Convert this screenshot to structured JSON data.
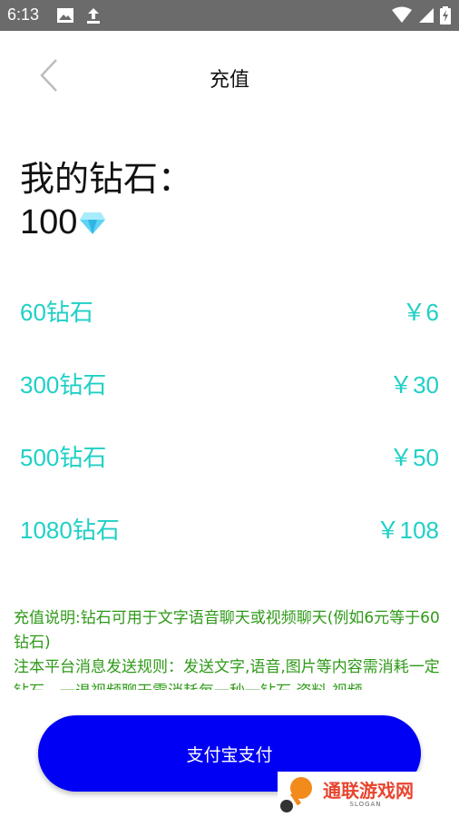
{
  "status_bar": {
    "time": "6:13"
  },
  "header": {
    "title": "充值"
  },
  "balance": {
    "label": "我的钻石：",
    "amount": "100"
  },
  "packages": [
    {
      "name": "60钻石",
      "price": "￥6"
    },
    {
      "name": "300钻石",
      "price": "￥30"
    },
    {
      "name": "500钻石",
      "price": "￥50"
    },
    {
      "name": "1080钻石",
      "price": "￥108"
    }
  ],
  "notice": {
    "line1": "充值说明:钻石可用于文字语音聊天或视频聊天(例如6元等于60钻石)",
    "line2": "注本平台消息发送规则：发送文字,语音,图片等内容需消耗一定钻石，一退视频聊天需消耗每一秒一钻石,资料,视频"
  },
  "pay_button": {
    "label": "支付宝支付"
  },
  "watermark": {
    "text": "通联游戏网",
    "slogan": "SLOGAN"
  },
  "colors": {
    "accent_teal": "#1fd0c6",
    "notice_green": "#2e9a18",
    "pay_blue": "#0000f5",
    "status_gray": "#6b6b6b"
  }
}
